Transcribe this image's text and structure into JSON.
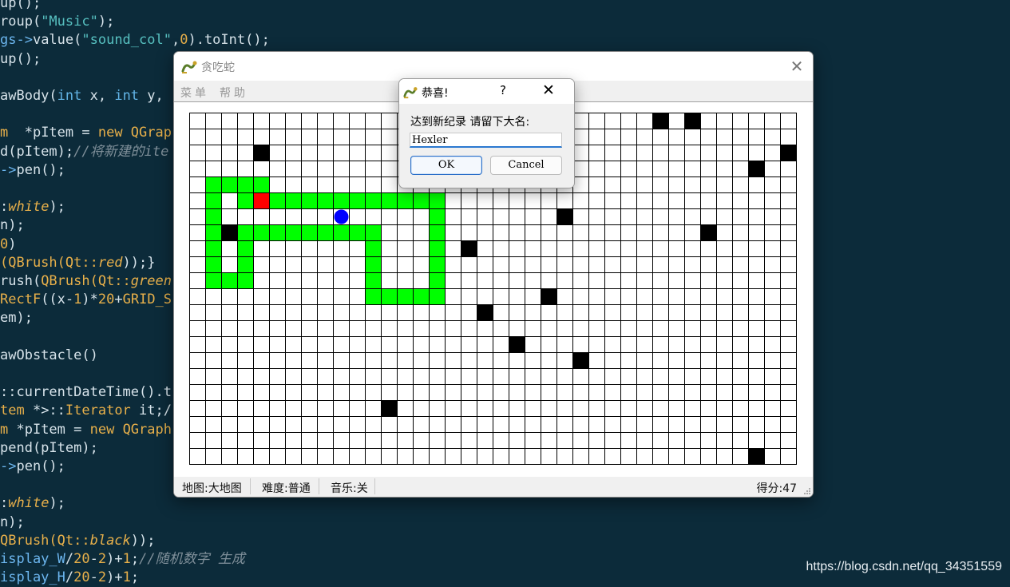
{
  "editor": {
    "lines": [
      [
        {
          "t": "up();"
        }
      ],
      [
        {
          "t": "roup("
        },
        {
          "t": "\"Music\"",
          "c": "str"
        },
        {
          "t": ");"
        }
      ],
      [
        {
          "t": "gs->",
          "c": "op"
        },
        {
          "t": "value("
        },
        {
          "t": "\"sound_col\"",
          "c": "str"
        },
        {
          "t": ","
        },
        {
          "t": "0",
          "c": "num"
        },
        {
          "t": ").toInt();"
        }
      ],
      [
        {
          "t": "up();"
        }
      ],
      [
        {
          "t": ""
        }
      ],
      [
        {
          "t": "awBody("
        },
        {
          "t": "int",
          "c": "type"
        },
        {
          "t": " x, "
        },
        {
          "t": "int",
          "c": "type"
        },
        {
          "t": " y,"
        }
      ],
      [
        {
          "t": ""
        }
      ],
      [
        {
          "t": "m",
          "c": "kw"
        },
        {
          "t": "  *pItem = "
        },
        {
          "t": "new",
          "c": "kw"
        },
        {
          "t": " QGrap",
          "c": "kw"
        }
      ],
      [
        {
          "t": "d(pItem);"
        },
        {
          "t": "//将新建的ite",
          "c": "com"
        }
      ],
      [
        {
          "t": "->",
          "c": "op"
        },
        {
          "t": "pen();"
        }
      ],
      [
        {
          "t": ""
        }
      ],
      [
        {
          "t": ":"
        },
        {
          "t": "white",
          "c": "it"
        },
        {
          "t": ");"
        }
      ],
      [
        {
          "t": "n);"
        }
      ],
      [
        {
          "t": "0",
          "c": "num"
        },
        {
          "t": ")"
        }
      ],
      [
        {
          "t": "(QBrush(Qt::",
          "c": "kw"
        },
        {
          "t": "red",
          "c": "it"
        },
        {
          "t": "));}"
        }
      ],
      [
        {
          "t": "rush("
        },
        {
          "t": "QBrush(Qt::",
          "c": "kw"
        },
        {
          "t": "green",
          "c": "it"
        }
      ],
      [
        {
          "t": "RectF",
          "c": "kw"
        },
        {
          "t": "((x-"
        },
        {
          "t": "1",
          "c": "num"
        },
        {
          "t": ")*"
        },
        {
          "t": "20",
          "c": "num"
        },
        {
          "t": "+"
        },
        {
          "t": "GRID_S",
          "c": "kw"
        }
      ],
      [
        {
          "t": "em);"
        }
      ],
      [
        {
          "t": ""
        }
      ],
      [
        {
          "t": "awObstacle()"
        }
      ],
      [
        {
          "t": ""
        }
      ],
      [
        {
          "t": "::currentDateTime().t"
        }
      ],
      [
        {
          "t": "tem",
          "c": "kw"
        },
        {
          "t": " *>::"
        },
        {
          "t": "Iterator",
          "c": "kw"
        },
        {
          "t": " it;/"
        }
      ],
      [
        {
          "t": "m",
          "c": "kw"
        },
        {
          "t": " *pItem = "
        },
        {
          "t": "new",
          "c": "kw"
        },
        {
          "t": " QGraph",
          "c": "kw"
        }
      ],
      [
        {
          "t": "pend(pItem);"
        }
      ],
      [
        {
          "t": "->",
          "c": "op"
        },
        {
          "t": "pen();"
        }
      ],
      [
        {
          "t": ""
        }
      ],
      [
        {
          "t": ":"
        },
        {
          "t": "white",
          "c": "it"
        },
        {
          "t": ");"
        }
      ],
      [
        {
          "t": "n);"
        }
      ],
      [
        {
          "t": "QBrush(Qt::",
          "c": "kw"
        },
        {
          "t": "black",
          "c": "it"
        },
        {
          "t": "));"
        }
      ],
      [
        {
          "t": "isplay_W",
          "c": "op"
        },
        {
          "t": "/"
        },
        {
          "t": "20",
          "c": "num"
        },
        {
          "t": "-"
        },
        {
          "t": "2",
          "c": "num"
        },
        {
          "t": ")+"
        },
        {
          "t": "1",
          "c": "num"
        },
        {
          "t": ";"
        },
        {
          "t": "//随机数字 生成",
          "c": "com"
        }
      ],
      [
        {
          "t": "isplay_H",
          "c": "op"
        },
        {
          "t": "/"
        },
        {
          "t": "20",
          "c": "num"
        },
        {
          "t": "-"
        },
        {
          "t": "2",
          "c": "num"
        },
        {
          "t": ")+"
        },
        {
          "t": "1",
          "c": "num"
        },
        {
          "t": ";"
        }
      ]
    ]
  },
  "watermark": "https://blog.csdn.net/qq_34351559",
  "window": {
    "title": "贪吃蛇",
    "close_glyph": "✕",
    "menu": [
      "菜单",
      "帮助"
    ]
  },
  "board": {
    "cols": 38,
    "rows": 22,
    "colors": {
      "snake": "#00ff00",
      "head": "#ff0000",
      "food": "#0000ff",
      "obstacle": "#000000",
      "grid": "#000000"
    },
    "head": [
      4,
      5
    ],
    "food": [
      9,
      6
    ],
    "snake": [
      [
        1,
        4
      ],
      [
        2,
        4
      ],
      [
        3,
        4
      ],
      [
        4,
        4
      ],
      [
        1,
        5
      ],
      [
        3,
        5
      ],
      [
        5,
        5
      ],
      [
        6,
        5
      ],
      [
        7,
        5
      ],
      [
        8,
        5
      ],
      [
        9,
        5
      ],
      [
        10,
        5
      ],
      [
        11,
        5
      ],
      [
        12,
        5
      ],
      [
        13,
        5
      ],
      [
        14,
        5
      ],
      [
        15,
        5
      ],
      [
        1,
        6
      ],
      [
        15,
        6
      ],
      [
        1,
        7
      ],
      [
        3,
        7
      ],
      [
        4,
        7
      ],
      [
        5,
        7
      ],
      [
        6,
        7
      ],
      [
        7,
        7
      ],
      [
        8,
        7
      ],
      [
        9,
        7
      ],
      [
        10,
        7
      ],
      [
        11,
        7
      ],
      [
        15,
        7
      ],
      [
        1,
        8
      ],
      [
        3,
        8
      ],
      [
        11,
        8
      ],
      [
        15,
        8
      ],
      [
        1,
        9
      ],
      [
        3,
        9
      ],
      [
        11,
        9
      ],
      [
        15,
        9
      ],
      [
        1,
        10
      ],
      [
        2,
        10
      ],
      [
        3,
        10
      ],
      [
        11,
        10
      ],
      [
        15,
        10
      ],
      [
        11,
        11
      ],
      [
        12,
        11
      ],
      [
        13,
        11
      ],
      [
        14,
        11
      ],
      [
        15,
        11
      ]
    ],
    "obstacles": [
      [
        29,
        0
      ],
      [
        31,
        0
      ],
      [
        4,
        2
      ],
      [
        37,
        2
      ],
      [
        35,
        3
      ],
      [
        23,
        6
      ],
      [
        2,
        7
      ],
      [
        32,
        7
      ],
      [
        17,
        8
      ],
      [
        22,
        11
      ],
      [
        18,
        12
      ],
      [
        20,
        14
      ],
      [
        24,
        15
      ],
      [
        12,
        18
      ],
      [
        35,
        21
      ]
    ]
  },
  "status": {
    "map": "地图:大地图",
    "difficulty": "难度:普通",
    "music": "音乐:关",
    "score": "得分:47"
  },
  "dialog": {
    "title": "恭喜!",
    "help_glyph": "?",
    "close_glyph": "✕",
    "label": "达到新纪录 请留下大名:",
    "input_value": "Hexler",
    "ok_label": "OK",
    "cancel_label": "Cancel"
  }
}
